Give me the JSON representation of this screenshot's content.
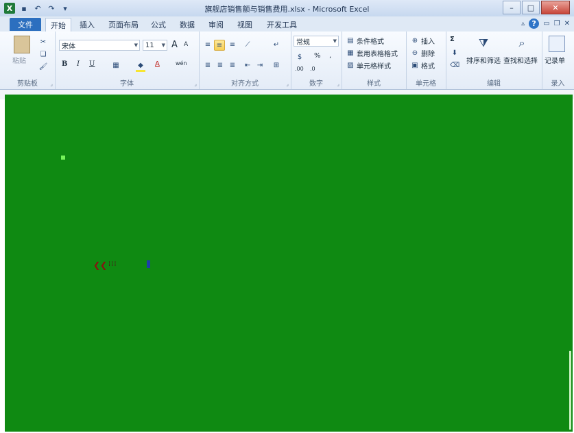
{
  "window": {
    "title": "旗舰店销售额与销售费用.xlsx - Microsoft Excel",
    "app_icon": "X",
    "minimize": "–",
    "maximize": "□",
    "close": "✕"
  },
  "tabs": {
    "file": "文件",
    "items": [
      "开始",
      "插入",
      "页面布局",
      "公式",
      "数据",
      "审阅",
      "视图",
      "开发工具"
    ]
  },
  "ribbon": {
    "clipboard": {
      "label": "剪贴板",
      "paste": "粘贴"
    },
    "font": {
      "label": "字体",
      "font_name": "宋体",
      "font_size": "11",
      "grow": "A",
      "shrink": "A",
      "bold": "B",
      "italic": "I",
      "underline": "U",
      "font_color": "A",
      "phonetic": "wén"
    },
    "alignment": {
      "label": "对齐方式"
    },
    "number": {
      "label": "数字",
      "format": "常规",
      "percent": "%",
      "comma": ",",
      "inc_decimal": ".00",
      "dec_decimal": ".0"
    },
    "styles": {
      "label": "样式",
      "conditional": "条件格式",
      "table": "套用表格格式",
      "cell_styles": "单元格样式"
    },
    "cells": {
      "label": "单元格",
      "insert": "插入",
      "delete": "删除",
      "format": "格式"
    },
    "editing": {
      "label": "编辑",
      "sum": "Σ",
      "sort_filter": "排序和筛选",
      "find_select": "查找和选择"
    },
    "record": {
      "label": "录入",
      "form": "记录单"
    }
  },
  "colors": {
    "sheet": "#0f8a12",
    "file_tab": "#2c6fbf"
  }
}
